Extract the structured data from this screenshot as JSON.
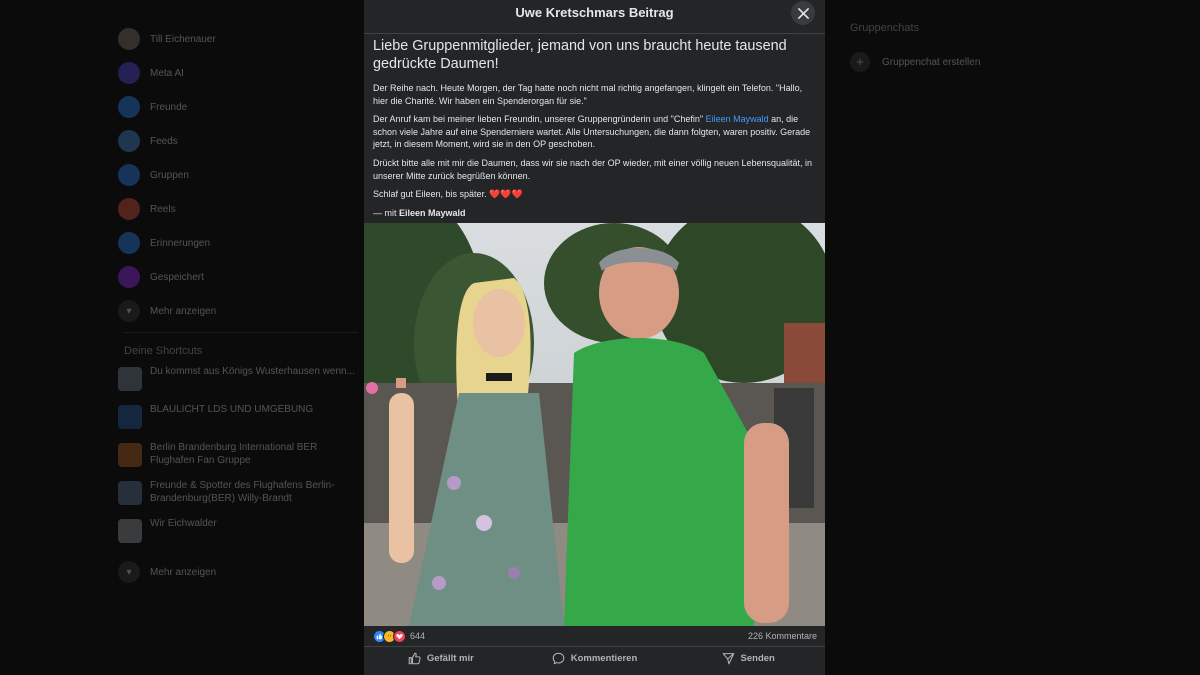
{
  "sidebar": {
    "items": [
      {
        "label": "Till Eichenauer",
        "icon": "avatar-icon",
        "color": "#8c7b6b"
      },
      {
        "label": "Meta AI",
        "icon": "meta-ai-icon",
        "color": "#5b4ce8"
      },
      {
        "label": "Freunde",
        "icon": "friends-icon",
        "color": "#2d88ff"
      },
      {
        "label": "Feeds",
        "icon": "feeds-icon",
        "color": "#4a90d9"
      },
      {
        "label": "Gruppen",
        "icon": "groups-icon",
        "color": "#2d88ff"
      },
      {
        "label": "Reels",
        "icon": "reels-icon",
        "color": "#e9563f"
      },
      {
        "label": "Erinnerungen",
        "icon": "memories-icon",
        "color": "#2d88ff"
      },
      {
        "label": "Gespeichert",
        "icon": "saved-icon",
        "color": "#a033ff"
      }
    ],
    "more_label": "Mehr anzeigen",
    "shortcuts_title": "Deine Shortcuts",
    "shortcuts": [
      {
        "label": "Du kommst aus Königs Wusterhausen wenn...",
        "color": "#7a8c99"
      },
      {
        "label": "BLAULICHT LDS UND UMGEBUNG",
        "color": "#2b5fb0"
      },
      {
        "label": "Berlin Brandenburg International BER Flughafen Fan Gruppe",
        "color": "#c06a2a"
      },
      {
        "label": "Freunde & Spotter des Flughafens Berlin-Brandenburg(BER) Willy-Brandt",
        "color": "#5c7f9e"
      },
      {
        "label": "Wir Eichwalder",
        "color": "#9aa0a6"
      }
    ],
    "more_label_2": "Mehr anzeigen"
  },
  "right": {
    "group_chats_title": "Gruppenchats",
    "create_group_chat": "Gruppenchat erstellen"
  },
  "modal": {
    "title": "Uwe Kretschmars Beitrag",
    "headline": "Liebe Gruppenmitglieder, jemand von uns braucht heute tausend gedrückte Daumen!",
    "p1": "Der Reihe nach. Heute Morgen, der Tag hatte noch nicht mal richtig angefangen, klingelt ein Telefon. \"Hallo, hier die Charité. Wir haben ein Spenderorgan für sie.\"",
    "p2_before": "Der Anruf kam bei meiner lieben Freundin, unserer Gruppengründerin und \"Chefin\" ",
    "p2_link": "Eileen Maywald",
    "p2_after": " an, die schon viele Jahre auf eine Spenderniere wartet. Alle Untersuchungen, die dann folgten, waren positiv. Gerade jetzt, in diesem Moment, wird sie in den OP geschoben.",
    "p3": "Drückt bitte alle mit mir die Daumen, dass wir sie nach der OP wieder, mit einer völlig neuen Lebensqualität, in unserer Mitte zurück begrüßen können.",
    "p4": "Schlaf gut Eileen, bis später. ❤️❤️❤️",
    "with_prefix": "— mit ",
    "with_name": "Eileen Maywald",
    "reaction_count": "644",
    "comment_count": "226 Kommentare",
    "like_label": "Gefällt mir",
    "comment_label": "Kommentieren",
    "send_label": "Senden"
  },
  "colors": {
    "modal_bg": "#242526",
    "page_bg": "#0b0b0c",
    "link": "#4599ff",
    "like": "#2d88ff",
    "love": "#f33e58",
    "care": "#f7b928"
  }
}
